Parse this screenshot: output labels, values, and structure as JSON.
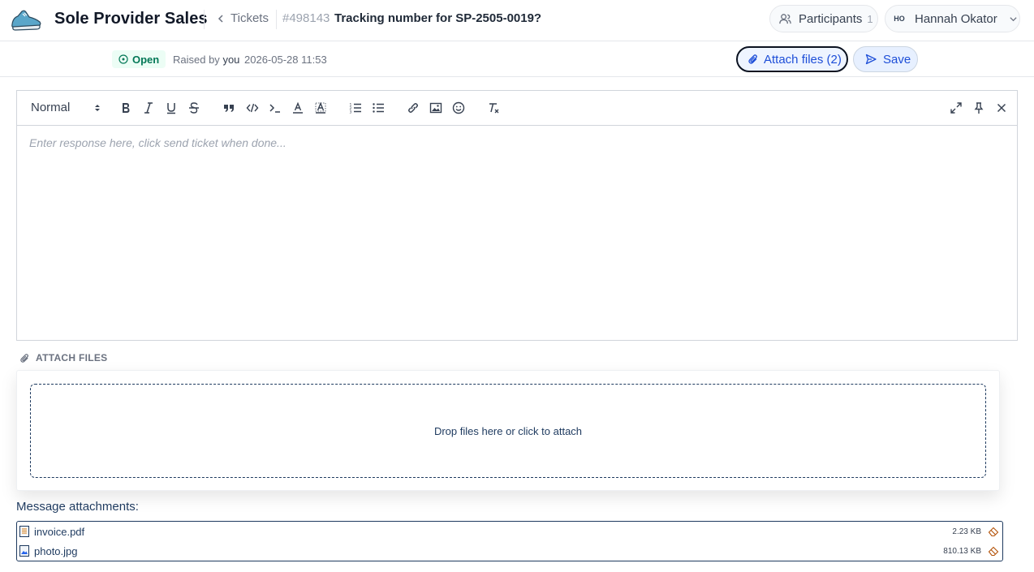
{
  "header": {
    "app_title": "Sole Provider Sales",
    "back_label": "Tickets",
    "ticket_id": "#498143",
    "ticket_title": "Tracking number for SP-2505-0019?",
    "participants_label": "Participants",
    "participants_count": "1",
    "user_initials": "HO",
    "user_name": "Hannah Okator"
  },
  "subheader": {
    "status": "Open",
    "raised_prefix": "Raised by",
    "raised_by": "you",
    "raised_date": "2026-05-28 11:53",
    "attach_button": "Attach files (2)",
    "save_button": "Save"
  },
  "editor": {
    "format_value": "Normal",
    "placeholder": "Enter response here, click send ticket when done..."
  },
  "attach": {
    "heading": "ATTACH FILES",
    "drop_text": "Drop files here or click to attach",
    "message_attachments_label": "Message attachments:",
    "files": [
      {
        "name": "invoice.pdf",
        "size": "2.23 KB"
      },
      {
        "name": "photo.jpg",
        "size": "810.13 KB"
      }
    ]
  },
  "colors": {
    "accent": "#1d4ed8",
    "status_green": "#047857",
    "navy": "#1e3a5f"
  }
}
